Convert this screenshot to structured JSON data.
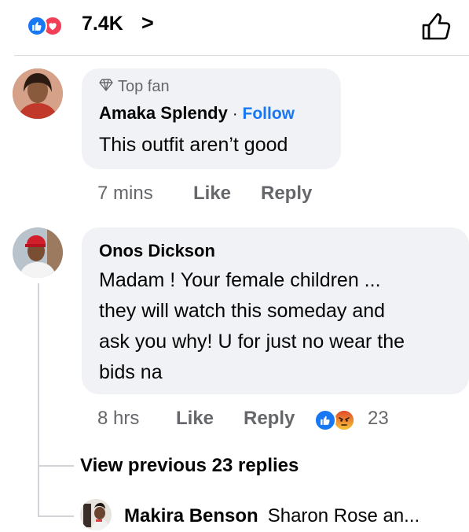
{
  "top_bar": {
    "reaction_count": "7.4K",
    "chevron": ">",
    "reactions": [
      "like",
      "love"
    ],
    "colors": {
      "like": "#1877f2",
      "love": "#f33e58"
    }
  },
  "comments": [
    {
      "badge": "Top fan",
      "author": "Amaka Splendy",
      "separator": "·",
      "follow_label": "Follow",
      "text": "This outfit aren’t good",
      "time": "7 mins",
      "like_label": "Like",
      "reply_label": "Reply"
    },
    {
      "author": "Onos Dickson",
      "text_lines": [
        "Madam ! Your female children ...",
        "they will watch this someday and",
        "ask you why! U for just no wear the",
        "bids na"
      ],
      "time": "8 hrs",
      "like_label": "Like",
      "reply_label": "Reply",
      "reaction_count": "23",
      "reactions": [
        "like",
        "angry"
      ],
      "colors": {
        "like": "#1877f2",
        "angry": "#e9710f"
      }
    }
  ],
  "view_previous": "View previous 23 replies",
  "reply_preview": {
    "author": "Makira Benson",
    "text": "Sharon Rose an..."
  },
  "icons": {
    "like_thumb": "thumbs-up-outline-icon",
    "top_fan": "diamond-icon"
  }
}
